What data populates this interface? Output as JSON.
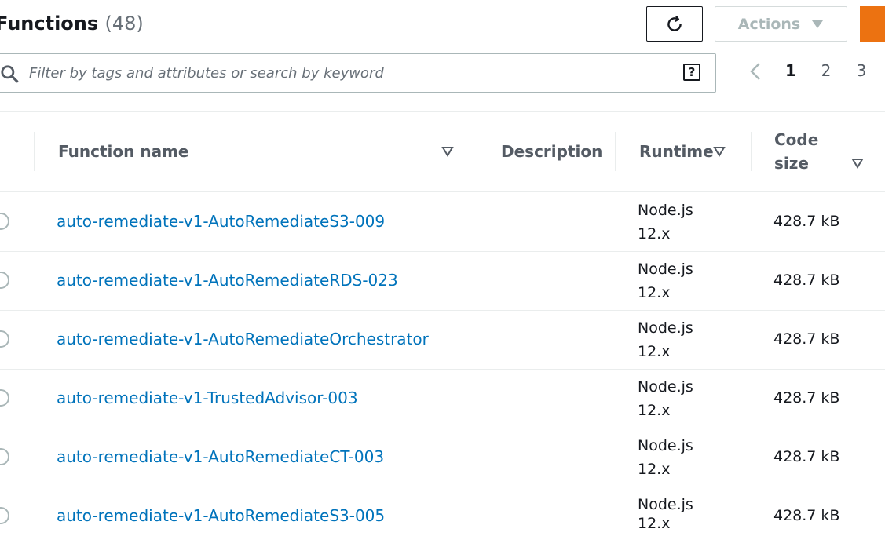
{
  "header": {
    "title": "Functions",
    "count": "(48)"
  },
  "toolbar": {
    "actions_label": "Actions"
  },
  "search": {
    "placeholder": "Filter by tags and attributes or search by keyword",
    "help": "?"
  },
  "pagination": {
    "pages": [
      "1",
      "2",
      "3"
    ],
    "current": "1"
  },
  "table": {
    "columns": [
      {
        "label": "Function name",
        "sortable": true
      },
      {
        "label": "Description",
        "sortable": false
      },
      {
        "label": "Runtime",
        "sortable": true
      },
      {
        "label": "Code size",
        "sortable": true,
        "lines": [
          "Code",
          "size"
        ]
      }
    ],
    "rows": [
      {
        "name": "auto-remediate-v1-AutoRemediateS3-009",
        "description": "",
        "runtime_1": "Node.js",
        "runtime_2": "12.x",
        "code_size": "428.7 kB"
      },
      {
        "name": "auto-remediate-v1-AutoRemediateRDS-023",
        "description": "",
        "runtime_1": "Node.js",
        "runtime_2": "12.x",
        "code_size": "428.7 kB"
      },
      {
        "name": "auto-remediate-v1-AutoRemediateOrchestrator",
        "description": "",
        "runtime_1": "Node.js",
        "runtime_2": "12.x",
        "code_size": "428.7 kB"
      },
      {
        "name": "auto-remediate-v1-TrustedAdvisor-003",
        "description": "",
        "runtime_1": "Node.js",
        "runtime_2": "12.x",
        "code_size": "428.7 kB"
      },
      {
        "name": "auto-remediate-v1-AutoRemediateCT-003",
        "description": "",
        "runtime_1": "Node.js",
        "runtime_2": "12.x",
        "code_size": "428.7 kB"
      },
      {
        "name": "auto-remediate-v1-AutoRemediateS3-005",
        "description": "",
        "runtime_1": "Node.js",
        "runtime_2": "12.x",
        "code_size": "428.7 kB"
      }
    ]
  },
  "colors": {
    "link": "#0073bb",
    "primary": "#ec7211",
    "border": "#eaeded",
    "header_text": "#545b64"
  },
  "icons": {
    "refresh": "refresh-icon",
    "dropdown": "caret-down-icon",
    "search": "search-icon",
    "help": "help-icon",
    "prev": "chevron-left-icon",
    "sort": "sort-icon"
  }
}
